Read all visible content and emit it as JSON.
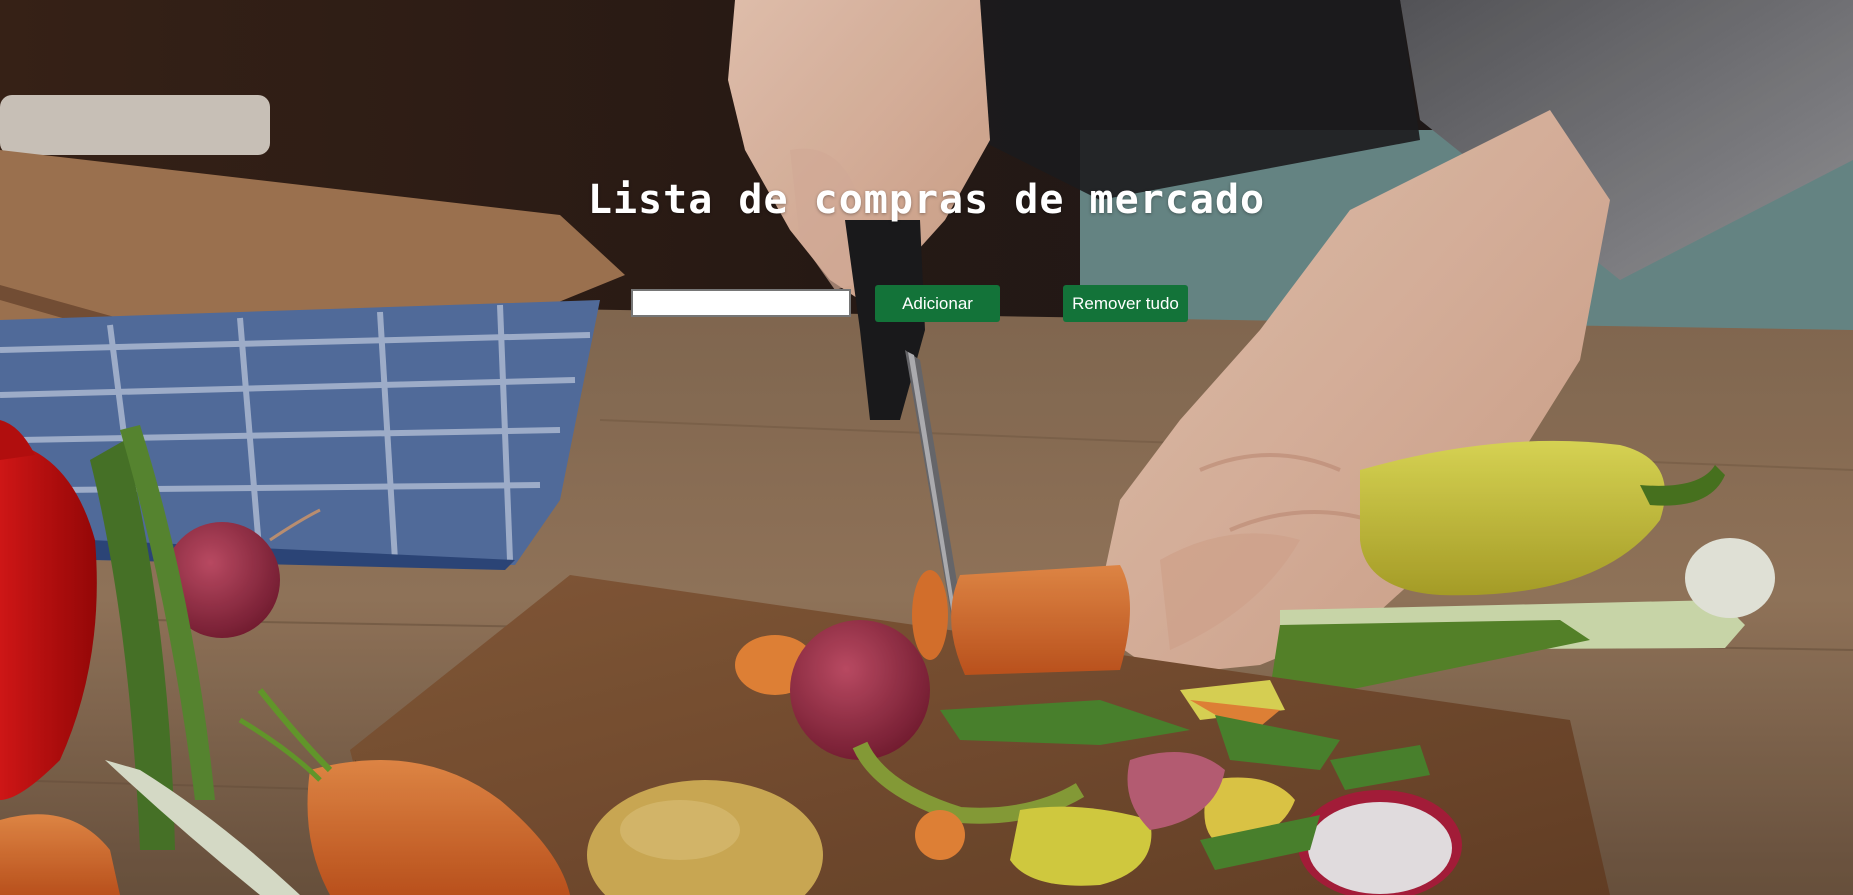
{
  "page": {
    "title": "Lista de compras de mercado"
  },
  "form": {
    "input_value": "",
    "input_placeholder": "",
    "add_label": "Adicionar",
    "clear_label": "Remover tudo"
  },
  "colors": {
    "button_bg": "#137339",
    "button_text": "#ffffff",
    "title_text": "#ffffff"
  }
}
